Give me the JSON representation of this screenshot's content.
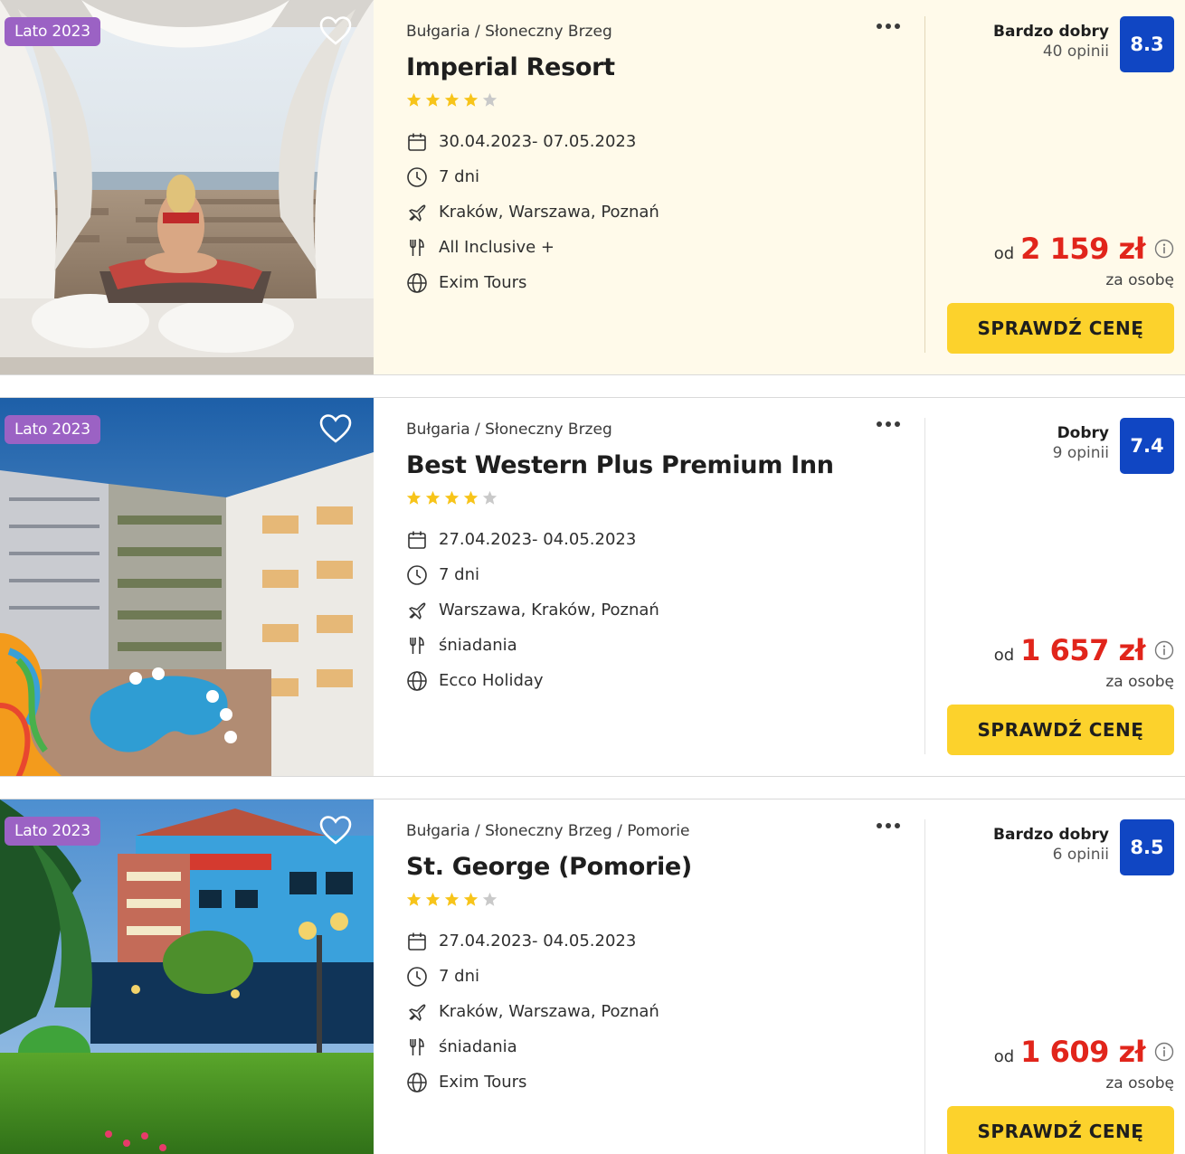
{
  "offers": [
    {
      "badge": "Lato 2023",
      "location": "Bułgaria / Słoneczny Brzeg",
      "name": "Imperial Resort",
      "stars": 4,
      "dates": "30.04.2023- 07.05.2023",
      "duration": "7 dni",
      "departure": "Kraków, Warszawa, Poznań",
      "board": "All Inclusive +",
      "operator": "Exim Tours",
      "rating_label": "Bardzo dobry",
      "reviews": "40 opinii",
      "score": "8.3",
      "price_prefix": "od",
      "price": "2 159 zł",
      "per_person": "za osobę",
      "cta": "SPRAWDŹ CENĘ",
      "highlighted": true
    },
    {
      "badge": "Lato 2023",
      "location": "Bułgaria / Słoneczny Brzeg",
      "name": "Best Western Plus Premium Inn",
      "stars": 4,
      "dates": "27.04.2023- 04.05.2023",
      "duration": "7 dni",
      "departure": "Warszawa, Kraków, Poznań",
      "board": "śniadania",
      "operator": "Ecco Holiday",
      "rating_label": "Dobry",
      "reviews": "9 opinii",
      "score": "7.4",
      "price_prefix": "od",
      "price": "1 657 zł",
      "per_person": "za osobę",
      "cta": "SPRAWDŹ CENĘ",
      "highlighted": false
    },
    {
      "badge": "Lato 2023",
      "location": "Bułgaria / Słoneczny Brzeg / Pomorie",
      "name": "St. George (Pomorie)",
      "stars": 4,
      "dates": "27.04.2023- 04.05.2023",
      "duration": "7 dni",
      "departure": "Kraków, Warszawa, Poznań",
      "board": "śniadania",
      "operator": "Exim Tours",
      "rating_label": "Bardzo dobry",
      "reviews": "6 opinii",
      "score": "8.5",
      "price_prefix": "od",
      "price": "1 609 zł",
      "per_person": "za osobę",
      "cta": "SPRAWDŹ CENĘ",
      "highlighted": false
    }
  ],
  "colors": {
    "badge": "#9b62c4",
    "score": "#1046c3",
    "price": "#e1251b",
    "cta": "#fcd22c",
    "star_filled": "#f7c41a",
    "star_empty": "#c9c9c9",
    "highlight_bg": "#fffaea"
  },
  "icons": [
    "heart-icon",
    "more-dots-icon",
    "calendar-icon",
    "clock-icon",
    "plane-icon",
    "cutlery-icon",
    "globe-icon",
    "info-icon",
    "star-icon"
  ]
}
